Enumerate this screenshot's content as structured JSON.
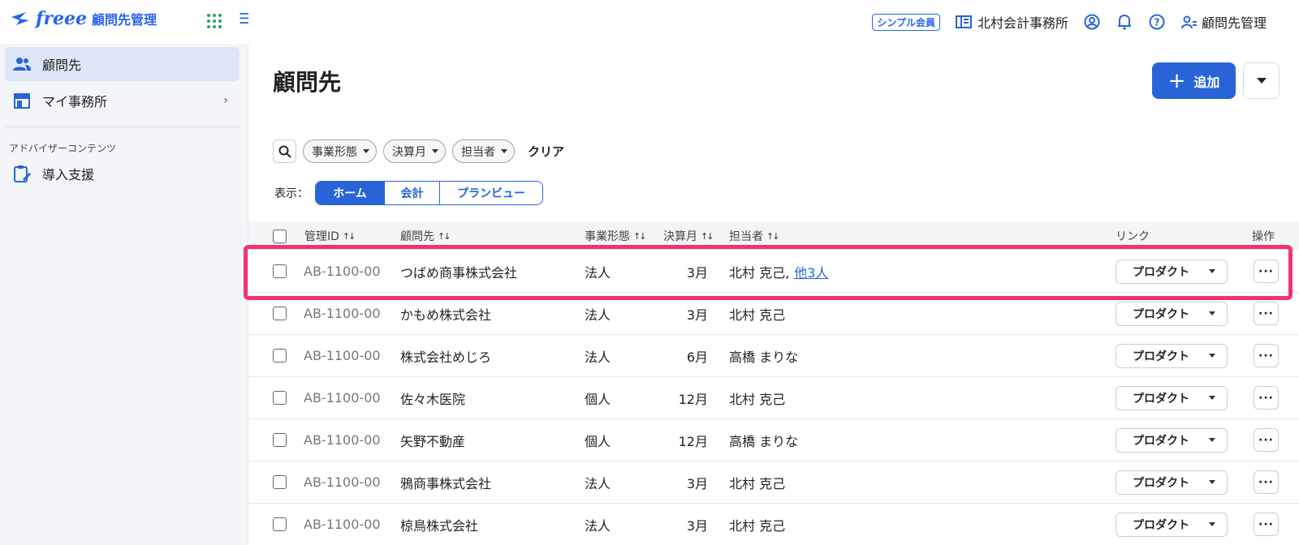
{
  "app": {
    "logo_text": "freee",
    "product_name": "顧問先管理"
  },
  "sidebar": {
    "items": [
      {
        "label": "顧問先",
        "icon": "users-icon",
        "active": true
      },
      {
        "label": "マイ事務所",
        "icon": "store-icon",
        "active": false
      }
    ],
    "section_label": "アドバイザーコンテンツ",
    "section_items": [
      {
        "label": "導入支援",
        "icon": "clipboard-edit-icon"
      }
    ]
  },
  "header": {
    "plan_badge": "シンプル会員",
    "office_name": "北村会計事務所",
    "user_menu_label": "顧問先管理"
  },
  "main": {
    "title": "顧問先",
    "add_button": "追加",
    "filters": [
      "事業形態",
      "決算月",
      "担当者"
    ],
    "clear_label": "クリア",
    "view_label": "表示：",
    "view_tabs": [
      "ホーム",
      "会計",
      "プランビュー"
    ],
    "active_view": "ホーム"
  },
  "table": {
    "columns": {
      "id": "管理ID",
      "client": "顧問先",
      "type": "事業形態",
      "month": "決算月",
      "owner": "担当者",
      "link": "リンク",
      "actions": "操作"
    },
    "product_button": "プロダクト",
    "more_button": "···",
    "rows": [
      {
        "id": "AB-1100-00",
        "client": "つばめ商事株式会社",
        "type": "法人",
        "month": "3月",
        "owner": "北村 克己,",
        "owner_extra": "他3人",
        "highlighted": true
      },
      {
        "id": "AB-1100-00",
        "client": "かもめ株式会社",
        "type": "法人",
        "month": "3月",
        "owner": "北村 克己",
        "owner_extra": ""
      },
      {
        "id": "AB-1100-00",
        "client": "株式会社めじろ",
        "type": "法人",
        "month": "6月",
        "owner": "高橋 まりな",
        "owner_extra": ""
      },
      {
        "id": "AB-1100-00",
        "client": "佐々木医院",
        "type": "個人",
        "month": "12月",
        "owner": "北村 克己",
        "owner_extra": ""
      },
      {
        "id": "AB-1100-00",
        "client": "矢野不動産",
        "type": "個人",
        "month": "12月",
        "owner": "高橋 まりな",
        "owner_extra": ""
      },
      {
        "id": "AB-1100-00",
        "client": "鴉商事株式会社",
        "type": "法人",
        "month": "3月",
        "owner": "北村 克己",
        "owner_extra": ""
      },
      {
        "id": "AB-1100-00",
        "client": "椋鳥株式会社",
        "type": "法人",
        "month": "3月",
        "owner": "北村 克己",
        "owner_extra": ""
      }
    ]
  },
  "colors": {
    "accent": "#2864d8",
    "highlight": "#f2336b",
    "sidebar_bg": "#f3f5f8"
  }
}
